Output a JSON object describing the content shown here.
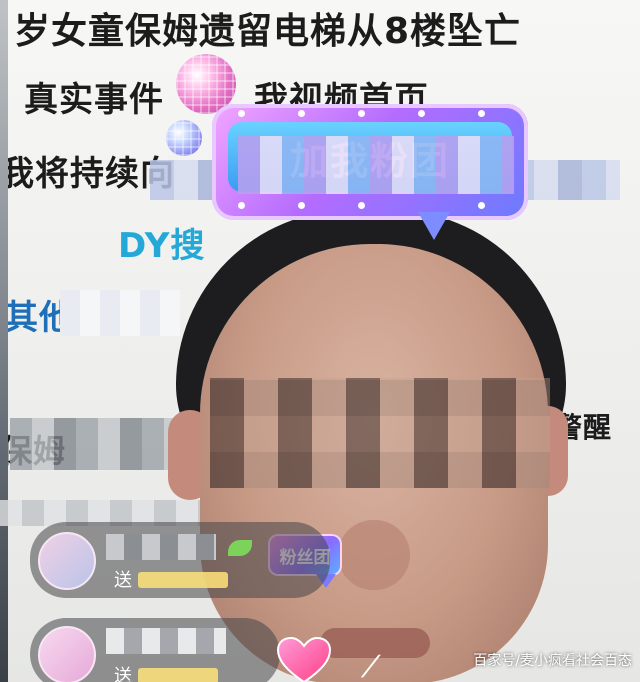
{
  "background_text": {
    "line1": "岁女童保姆遗留电梯从8楼坠亡",
    "line2": "真实事件",
    "line2_tail": "我视频首页",
    "line3": "我将持续向",
    "line4": "DY搜",
    "line5": "其他",
    "line6": "保姆",
    "line7": "警醒"
  },
  "live_badge": {
    "label": "加我粉团"
  },
  "fan_club_tag": {
    "label": "粉丝团"
  },
  "gift_rows": [
    {
      "action": "送"
    },
    {
      "action": "送"
    }
  ],
  "watermark": "百家号/麦小疯看社会百态",
  "icons": [
    "disco-ball-icon",
    "heart-icon",
    "leaf-icon",
    "chevron-icon"
  ],
  "colors": {
    "badge_pink": "#f3a6ff",
    "badge_purple": "#b46cff",
    "badge_blue": "#6a7bff",
    "blue_text": "#24a8d8",
    "dark_blue_text": "#1e6fb8"
  }
}
